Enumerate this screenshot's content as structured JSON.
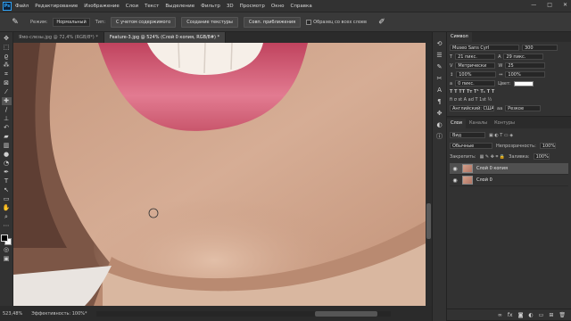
{
  "app": {
    "logo": "Ps"
  },
  "menu": [
    "Файл",
    "Редактирование",
    "Изображение",
    "Слои",
    "Текст",
    "Выделение",
    "Фильтр",
    "3D",
    "Просмотр",
    "Окно",
    "Справка"
  ],
  "window_controls": {
    "minimize": "—",
    "maximize": "□",
    "close": "✕"
  },
  "options": {
    "mode_label": "Режим:",
    "mode_value": "Нормальный",
    "type_label": "Тип:",
    "content_aware": "С учетом содержимого",
    "create_texture": "Создание текстуры",
    "proximity_match": "Совп. приближения",
    "sample_all_layers": "Образец со всех слоев"
  },
  "tabs": [
    {
      "label": "Ямо-слезы.jpg @ 72,4% (RGB/8*) *"
    },
    {
      "label": "Feature-3.jpg @ 524% (Слой 0 копия, RGB/8#) *"
    }
  ],
  "status": {
    "zoom": "523,48%",
    "info": "Эффективность: 100%*"
  },
  "character": {
    "tabs": [
      "Символ"
    ],
    "font_family": "Museo Sans Cyrl",
    "font_style": "300",
    "size": "21 пикс.",
    "leading": "29 пикс.",
    "kerning": "Метрически",
    "tracking": "25",
    "vscale": "100%",
    "hscale": "100%",
    "baseline": "0 пикс.",
    "color_label": "Цвет:",
    "language": "Английский: США",
    "aa_label": "аа",
    "aa_value": "Резкое"
  },
  "layers": {
    "tabs": [
      "Слои",
      "Каналы",
      "Контуры"
    ],
    "filter_label": "Вид",
    "blend_mode": "Обычные",
    "opacity_label": "Непрозрачность:",
    "opacity_value": "100%",
    "lock_label": "Закрепить:",
    "fill_label": "Заливка:",
    "fill_value": "100%",
    "items": [
      {
        "name": "Слой 0 копия",
        "selected": true
      },
      {
        "name": "Слой 0",
        "selected": false
      }
    ]
  },
  "colors": {
    "accent": "#31a8ff",
    "lip": "#d85a72",
    "skin": "#c9a38b"
  }
}
